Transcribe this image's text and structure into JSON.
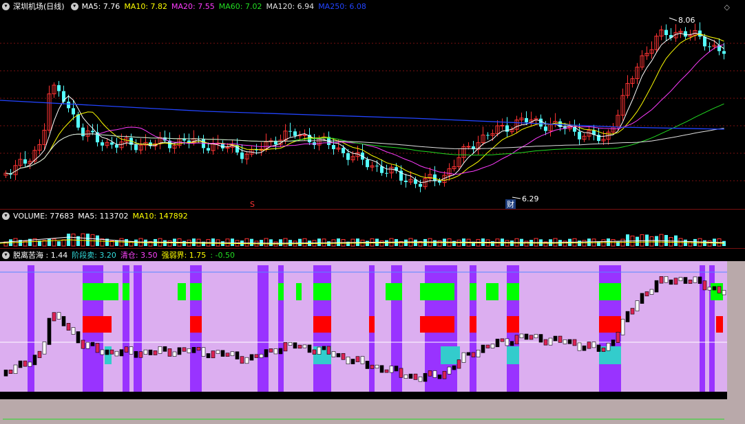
{
  "main": {
    "title": "深圳机场(日线)",
    "ma": [
      {
        "label": "MA5: 7.76",
        "color": "#ffffff"
      },
      {
        "label": "MA10: 7.82",
        "color": "#ffff00"
      },
      {
        "label": "MA20: 7.55",
        "color": "#ff3cff"
      },
      {
        "label": "MA60: 7.02",
        "color": "#22dd22"
      },
      {
        "label": "MA120: 6.94",
        "color": "#e0e0e0"
      },
      {
        "label": "MA250: 6.08",
        "color": "#2244ff"
      }
    ],
    "high_label": "8.06",
    "low_label": "6.29",
    "low_marker": "财",
    "s_marker": "S",
    "settings_glyph": "◇",
    "toggle_glyph": "▾"
  },
  "volume": {
    "labels": [
      {
        "text": "VOLUME: 77683",
        "color": "#ffffff"
      },
      {
        "text": "MA5: 113702",
        "color": "#ffffff"
      },
      {
        "text": "MA10: 147892",
        "color": "#ffff00"
      }
    ]
  },
  "indicator": {
    "labels": [
      {
        "text": "脱离苦海 : 1.44",
        "color": "#ffffff"
      },
      {
        "text": "阶段卖: 3.20",
        "color": "#33dddd"
      },
      {
        "text": "清仓: 3.50",
        "color": "#ff44ff"
      },
      {
        "text": "强弱界: 1.75",
        "color": "#ffff00"
      },
      {
        "text": ": -0.50",
        "color": "#22dd22"
      }
    ]
  },
  "colors": {
    "up": "#ff3333",
    "down": "#54ffff",
    "grid": "#7a1010",
    "zone_light": "#dcaef0",
    "zone_dark": "#9933ff",
    "zone_green": "#00ff00",
    "zone_red": "#ff0000",
    "zone_cyan": "#33cccc"
  }
}
